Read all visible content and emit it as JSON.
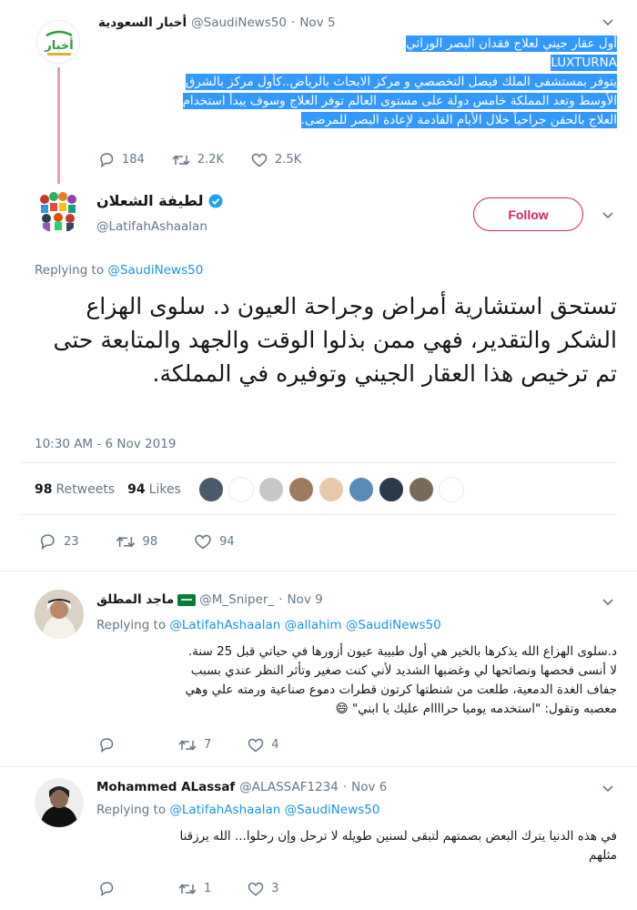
{
  "parent_tweet": {
    "display_name": "أخبار السعودية",
    "handle": "@SaudiNews50",
    "date": "Nov 5",
    "text_lines": [
      "أول عقار جيني لعلاج فقدان البصر الوراثي",
      "LUXTURNA",
      "يتوفر بمستشفى الملك فيصل التخصصي و مركز الابحاث بالرياض..كأول مركز بالشرق",
      "الأوسط وتعد المملكة خامس دولة على مستوى العالم توفر العلاج وسوف يبدأ استخدام",
      "العلاج بالحقن جراحياً خلال الأيام القادمة لإعادة البصر للمرضى."
    ],
    "replies": "184",
    "retweets": "2.2K",
    "likes": "2.5K",
    "avatar_text": "أخبار"
  },
  "main_tweet": {
    "display_name": "لطيفة الشعلان",
    "handle": "@LatifahAshaalan",
    "follow_label": "Follow",
    "replying_prefix": "Replying to",
    "replying_to": "@SaudiNews50",
    "text": "تستحق استشارية أمراض وجراحة العيون  د. سلوى الهزاع الشكر والتقدير، فهي ممن بذلوا الوقت والجهد والمتابعة حتى تم ترخيص هذا العقار الجيني وتوفيره في المملكة.",
    "timestamp": "10:30 AM - 6 Nov 2019",
    "retweets_count": "98",
    "retweets_label": "Retweets",
    "likes_count": "94",
    "likes_label": "Likes",
    "replies": "23",
    "retweets": "98",
    "likes": "94",
    "liker_avatar_colors": [
      "#4a5a6a",
      "#ffffff",
      "#c8c8c8",
      "#a07a5a",
      "#e8c8a8",
      "#5a8ab8",
      "#2a3a4a",
      "#7a6a5a",
      "#ffffff"
    ]
  },
  "reply1": {
    "display_name": "ماجد المطلق",
    "handle": "@M_Sniper_",
    "date": "Nov 9",
    "replying_prefix": "Replying to",
    "replying_to": [
      "@LatifahAshaalan",
      "@allahim",
      "@SaudiNews50"
    ],
    "text_lines": [
      "د.سلوى الهزاع الله يذكرها بالخير هي أول طبيبة عيون أزورها في حياتي قبل 25 سنة.",
      "لا أنسى فحصها ونصائحها لي وغضبها الشديد لأني كنت صغير وتأثر النظر عندي بسبب",
      "جفاف الغدة الدمعية، طلعت من شنطتها كرتون قطرات دموع صناعية ورمته علي وهي",
      "معصبه وتقول: \"استخدمه يوميا حراااام عليك يا ابني\" 😄"
    ],
    "replies": "",
    "retweets": "7",
    "likes": "4"
  },
  "reply2": {
    "display_name": "Mohammed ALassaf",
    "handle": "@ALASSAF1234",
    "date": "Nov 6",
    "replying_prefix": "Replying to",
    "replying_to": [
      "@LatifahAshaalan",
      "@SaudiNews50"
    ],
    "text_lines": [
      "في هذه الدنيا يترك البعض بصمتهم لتبقى لسنين طويله لا ترحل وإن رحلوا... الله يرزقنا",
      "مثلهم"
    ],
    "replies": "",
    "retweets": "1",
    "likes": "3"
  },
  "colors": {
    "accent_blue": "#1b95e0",
    "follow_red": "#d6245d",
    "selection": "#3399ff",
    "verified_blue": "#1da1f2"
  },
  "icons": [
    "reply-icon",
    "retweet-icon",
    "like-icon",
    "chevron-down-icon",
    "verified-badge-icon"
  ]
}
